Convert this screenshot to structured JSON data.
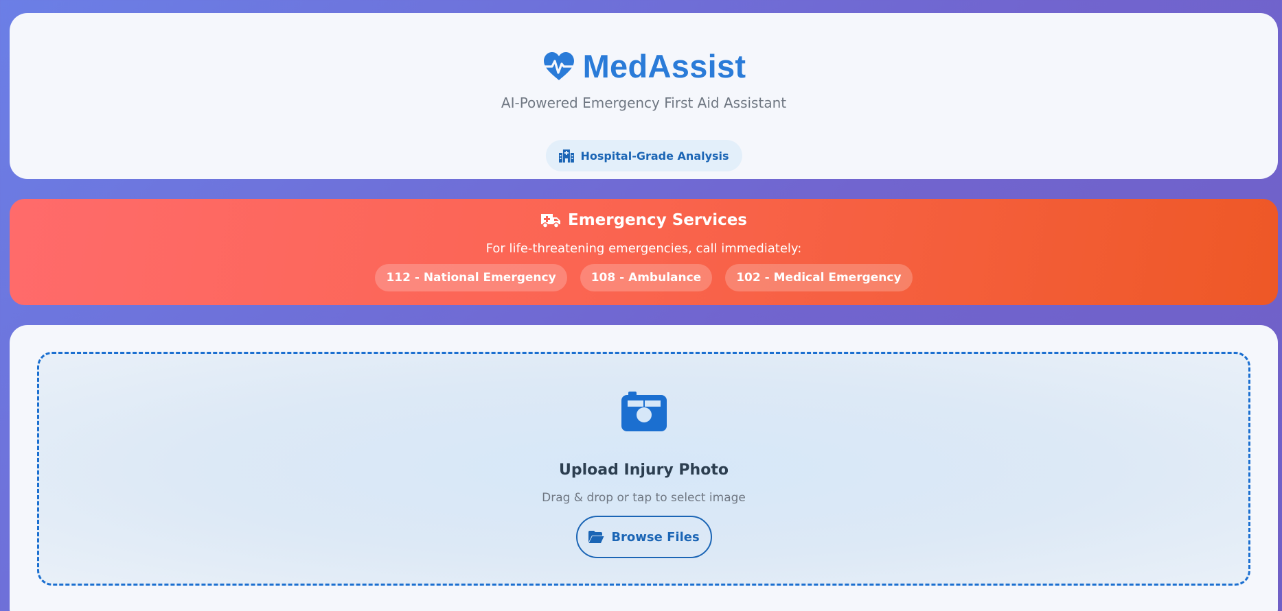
{
  "header": {
    "brand_icon": "heart-pulse-icon",
    "title": "MedAssist",
    "subtitle": "AI-Powered Emergency First Aid Assistant",
    "badge_icon": "hospital-icon",
    "badge_label": "Hospital-Grade Analysis"
  },
  "emergency": {
    "icon": "ambulance-icon",
    "title": "Emergency Services",
    "subtitle": "For life-threatening emergencies, call immediately:",
    "numbers": [
      {
        "label": "112 - National Emergency"
      },
      {
        "label": "108 - Ambulance"
      },
      {
        "label": "102 - Medical Emergency"
      }
    ]
  },
  "upload": {
    "icon": "camera-icon",
    "title": "Upload Injury Photo",
    "subtitle": "Drag & drop or tap to select image",
    "browse_icon": "folder-open-icon",
    "browse_label": "Browse Files"
  },
  "colors": {
    "primary": "#2a7bd8",
    "accent_blue": "#1b65b5",
    "emergency_start": "#ff6b6b",
    "emergency_end": "#ee5826",
    "background_start": "#6b7fe6",
    "background_end": "#6f5fc6"
  }
}
